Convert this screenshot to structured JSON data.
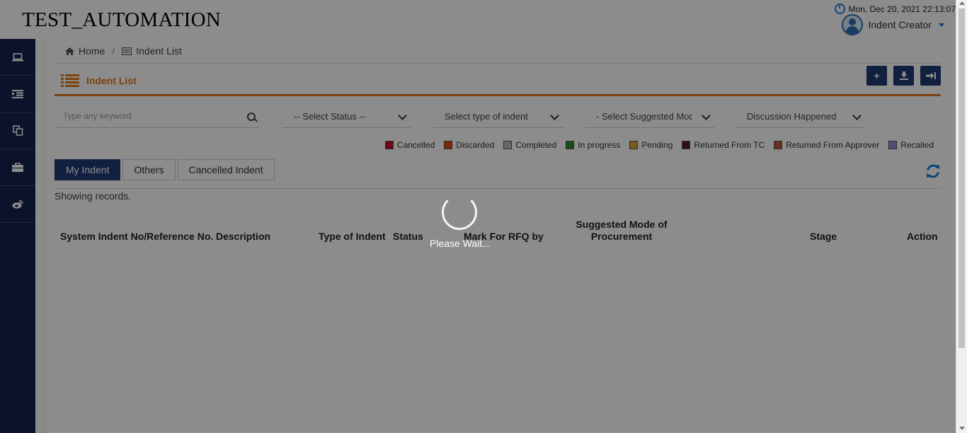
{
  "app": {
    "title": "TEST_AUTOMATION"
  },
  "header": {
    "datetime": "Mon, Dec 20, 2021 22:13:07",
    "user_role": "Indent Creator"
  },
  "sidebar": {
    "items": [
      {
        "icon": "laptop-icon"
      },
      {
        "icon": "indent-icon"
      },
      {
        "icon": "copy-icon"
      },
      {
        "icon": "briefcase-icon"
      },
      {
        "icon": "weibo-icon"
      }
    ]
  },
  "breadcrumb": {
    "home": "Home",
    "separator": "/",
    "current": "Indent List"
  },
  "panel": {
    "title": "Indent List"
  },
  "toolbar": {
    "add": "+",
    "download": "⭳",
    "signin": "⇥"
  },
  "filters": {
    "search_placeholder": "Type any keyword",
    "status": "-- Select Status --",
    "type": "Select type of indent",
    "mode": "- Select Suggested Mode of Procurement -",
    "discussion": "Discussion Happened"
  },
  "legend": [
    {
      "label": "Cancelled",
      "color": "#c8102e"
    },
    {
      "label": "Discarded",
      "color": "#e84a0c"
    },
    {
      "label": "Completed",
      "color": "#bdbdbd"
    },
    {
      "label": "In progress",
      "color": "#2e8b2e"
    },
    {
      "label": "Pending",
      "color": "#d9a640"
    },
    {
      "label": "Returned From TC",
      "color": "#5c1a33"
    },
    {
      "label": "Returned From Approver",
      "color": "#b85c3c"
    },
    {
      "label": "Recalled",
      "color": "#a58bd8"
    }
  ],
  "tabs": [
    "My Indent",
    "Others",
    "Cancelled Indent"
  ],
  "records": {
    "text": "Showing records."
  },
  "table": {
    "headers": [
      "System Indent No/Reference No.",
      "Description",
      "Type of Indent",
      "Status",
      "Mark For RFQ by",
      "Suggested Mode of Procurement",
      "Stage",
      "Action"
    ]
  },
  "loading": {
    "text": "Please Wait..."
  }
}
